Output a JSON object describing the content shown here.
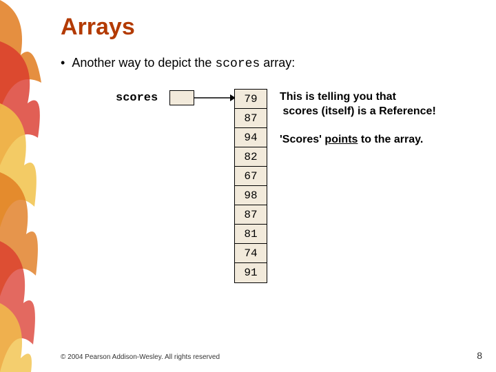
{
  "title": "Arrays",
  "bullet": {
    "prefix": "Another way to depict the ",
    "code": "scores",
    "suffix": " array:"
  },
  "label": "scores",
  "array_values": [
    "79",
    "87",
    "94",
    "82",
    "67",
    "98",
    "87",
    "81",
    "74",
    "91"
  ],
  "note1_a": "This is telling you that",
  "note1_b": "scores (itself) is a Reference!",
  "note2_a": "'Scores' ",
  "note2_underlined": "points",
  "note2_b": " to the array.",
  "footer": "© 2004 Pearson Addison-Wesley. All rights reserved",
  "page_number": "8"
}
